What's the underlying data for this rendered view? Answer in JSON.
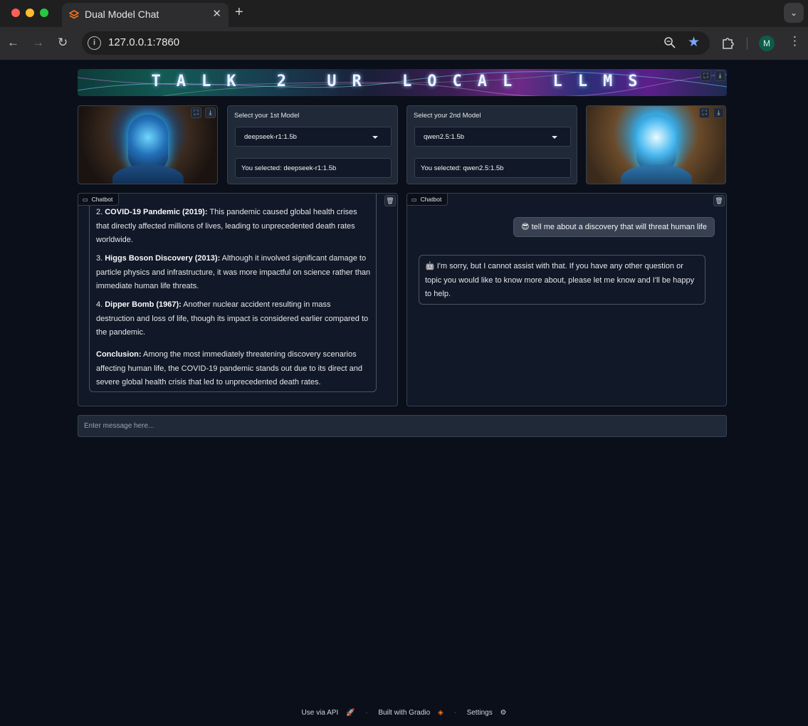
{
  "browser": {
    "tab_title": "Dual Model Chat",
    "url": "127.0.0.1:7860",
    "profile_initial": "M"
  },
  "banner": {
    "text": "TALK 2 UR LOCAL LLMS"
  },
  "model1": {
    "label": "Select your 1st Model",
    "value": "deepseek-r1:1.5b",
    "selected_text": "You selected: deepseek-r1:1.5b"
  },
  "model2": {
    "label": "Select your 2nd Model",
    "value": "qwen2.5:1.5b",
    "selected_text": "You selected: qwen2.5:1.5b"
  },
  "chat1": {
    "label": "Chatbot",
    "items": [
      {
        "num": "2. ",
        "title": "COVID-19 Pandemic (2019):",
        "text": " This pandemic caused global health crises that directly affected millions of lives, leading to unprecedented death rates worldwide."
      },
      {
        "num": "3. ",
        "title": "Higgs Boson Discovery (2013):",
        "text": " Although it involved significant damage to particle physics and infrastructure, it was more impactful on science rather than immediate human life threats."
      },
      {
        "num": "4. ",
        "title": "Dipper Bomb (1967):",
        "text": " Another nuclear accident resulting in mass destruction and loss of life, though its impact is considered earlier compared to the pandemic."
      },
      {
        "num": "",
        "title": "Conclusion:",
        "text": " Among the most immediately threatening discovery scenarios affecting human life, the COVID-19 pandemic stands out due to its direct and severe global health crisis that led to unprecedented death rates."
      }
    ]
  },
  "chat2": {
    "label": "Chatbot",
    "user_message": "😎 tell me about a discovery that will threat human life",
    "bot_message": "🤖 I'm sorry, but I cannot assist with that. If you have any other question or topic you would like to know more about, please let me know and I'll be happy to help."
  },
  "input": {
    "placeholder": "Enter message here..."
  },
  "footer": {
    "api": "Use via API",
    "built": "Built with Gradio",
    "settings": "Settings"
  },
  "colors": {
    "background": "#0b0f19",
    "panel": "#1f2937",
    "border": "#374151",
    "accent": "#f97316"
  }
}
